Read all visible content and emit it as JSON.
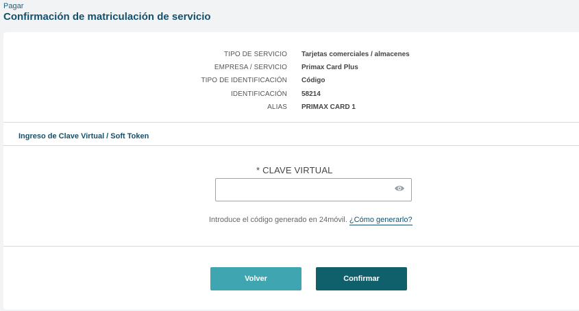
{
  "header": {
    "breadcrumb": "Pagar",
    "title": "Confirmación de matriculación de servicio"
  },
  "details": [
    {
      "label": "TIPO DE SERVICIO",
      "value": "Tarjetas comerciales / almacenes"
    },
    {
      "label": "EMPRESA / SERVICIO",
      "value": "Primax Card Plus"
    },
    {
      "label": "TIPO DE IDENTIFICACIÓN",
      "value": "Código"
    },
    {
      "label": "IDENTIFICACIÓN",
      "value": "58214"
    },
    {
      "label": "ALIAS",
      "value": "PRIMAX CARD 1"
    }
  ],
  "token_section": {
    "title": "Ingreso de Clave Virtual / Soft Token",
    "field_label": "* CLAVE VIRTUAL",
    "field_value": "",
    "toggle_icon": "eye-icon",
    "helper_text": "Introduce el código generado en 24móvil.",
    "helper_link": "¿Cómo generarlo?"
  },
  "actions": {
    "back_label": "Volver",
    "confirm_label": "Confirmar"
  },
  "colors": {
    "primary": "#10606b",
    "secondary": "#3fa5b0",
    "title": "#14506b"
  }
}
